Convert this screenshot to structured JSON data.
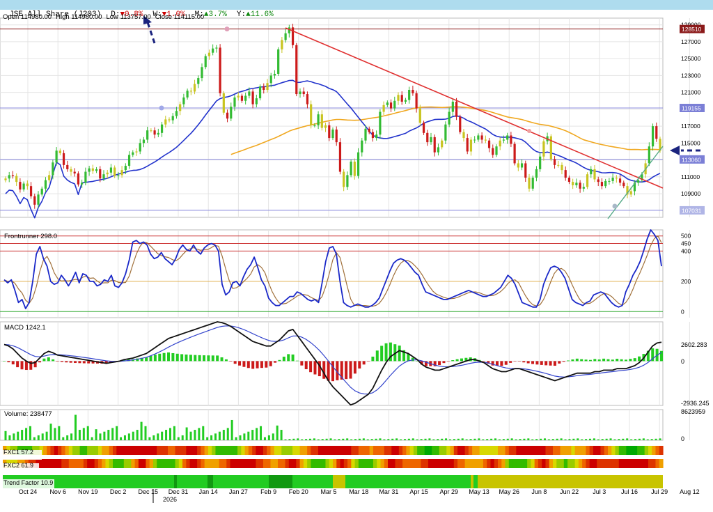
{
  "header": {
    "instrument": "JSE All Share (J203)",
    "d_label": "D:",
    "d_value": "0.8%",
    "w_label": "W:",
    "w_value": "1.0%",
    "m_label": "M:",
    "m_value": "3.7%",
    "y_label": "Y:",
    "y_value": "11.6%",
    "down_arrow": "▼",
    "up_arrow": "▲",
    "colors": {
      "down": "#cc0000",
      "up": "#118811",
      "bar": "#aedcee"
    }
  },
  "ohlc": {
    "open_label": "Open",
    "open": "114980.00",
    "high_label": "High",
    "high": "114980.00",
    "low_label": "Low",
    "low": "113757.00",
    "close_label": "Close",
    "close": "114115.00"
  },
  "chart_data": {
    "type": "candlestick",
    "x_ticks": [
      "Oct 24",
      "Nov 6",
      "Nov 19",
      "Dec 2",
      "Dec 15",
      "Dec 31",
      "Jan 14",
      "Jan 27",
      "Feb 9",
      "Feb 20",
      "Mar 5",
      "Mar 18",
      "Mar 31",
      "Apr 15",
      "Apr 29",
      "May 13",
      "May 26",
      "Jun 8",
      "Jun 22",
      "Jul 3",
      "Jul 16",
      "Jul 29",
      "Aug 12"
    ],
    "year_marker": "2026",
    "price_panel": {
      "y_ticks": [
        109000,
        111000,
        113000,
        115000,
        117000,
        119000,
        121000,
        123000,
        125000,
        127000,
        129000
      ],
      "ylim": [
        106200,
        129800
      ],
      "horizontal_levels": [
        {
          "label": "128510",
          "value": 128510,
          "color": "#8b1a1a",
          "badge": "#8b1a1a"
        },
        {
          "label": "119155",
          "value": 119155,
          "color": "#8888dd",
          "badge": "#7b7fd6"
        },
        {
          "label": "113060",
          "value": 113060,
          "color": "#8888dd",
          "badge": "#7b7fd6"
        },
        {
          "label": "107031",
          "value": 107031,
          "color": "#8888dd",
          "badge": "#b0b5e6"
        }
      ],
      "candles": [
        110800,
        111200,
        111100,
        110400,
        109500,
        110200,
        109900,
        108700,
        107700,
        108900,
        109600,
        110600,
        111200,
        112700,
        114100,
        113800,
        112400,
        111900,
        111600,
        111400,
        110100,
        110300,
        111600,
        112000,
        111700,
        111900,
        110800,
        111300,
        111500,
        112100,
        111100,
        111200,
        111800,
        112300,
        113600,
        113900,
        114000,
        115000,
        115400,
        116500,
        116500,
        116000,
        116200,
        117200,
        117800,
        117700,
        118200,
        118800,
        119600,
        120400,
        121200,
        121100,
        122000,
        122700,
        124000,
        125300,
        125700,
        126200,
        126300,
        120900,
        118600,
        117900,
        119300,
        120400,
        120600,
        120000,
        120600,
        121100,
        119600,
        120300,
        121700,
        121300,
        122100,
        123000,
        123200,
        126100,
        127200,
        128000,
        128700,
        126600,
        120800,
        121100,
        120800,
        119600,
        117100,
        117100,
        118400,
        116800,
        117100,
        115600,
        116600,
        115100,
        111600,
        109800,
        111200,
        112800,
        111100,
        113900,
        115300,
        116700,
        116300,
        115600,
        116000,
        118700,
        119500,
        119800,
        119100,
        120000,
        120700,
        119900,
        120100,
        121300,
        120900,
        119100,
        117400,
        116200,
        115100,
        115700,
        113900,
        114500,
        115300,
        117200,
        118700,
        119900,
        118100,
        116300,
        115600,
        114000,
        115400,
        115400,
        115900,
        115400,
        115300,
        114400,
        113600,
        114600,
        115300,
        115400,
        115900,
        114900,
        112600,
        112100,
        112600,
        110900,
        109600,
        110900,
        111900,
        113400,
        115200,
        115800,
        113100,
        112400,
        112400,
        111800,
        110900,
        110400,
        110000,
        110300,
        109600,
        109800,
        111300,
        111900,
        110700,
        110400,
        109900,
        110500,
        110500,
        110900,
        110800,
        110300,
        109900,
        108900,
        109300,
        110300,
        110600,
        111300,
        112600,
        114600,
        117000,
        115500,
        114100
      ]
    },
    "frontrunner": {
      "label": "Frontrunner",
      "value": "298.0",
      "y_ticks": [
        0,
        200,
        400,
        450,
        500
      ],
      "ylim": [
        -40,
        540
      ],
      "levels": [
        {
          "value": 500,
          "color": "#cc3333"
        },
        {
          "value": 450,
          "color": "#cc3333"
        },
        {
          "value": 400,
          "color": "#cc3333"
        },
        {
          "value": 200,
          "color": "#e0b050"
        },
        {
          "value": 0,
          "color": "#33aa33"
        }
      ],
      "series": [
        210,
        190,
        210,
        140,
        60,
        80,
        20,
        60,
        200,
        380,
        430,
        350,
        300,
        200,
        180,
        190,
        240,
        210,
        170,
        210,
        260,
        190,
        250,
        240,
        200,
        200,
        170,
        180,
        210,
        200,
        240,
        170,
        160,
        190,
        250,
        340,
        460,
        470,
        450,
        460,
        440,
        380,
        350,
        360,
        390,
        350,
        330,
        310,
        350,
        410,
        440,
        410,
        400,
        440,
        400,
        380,
        420,
        440,
        450,
        440,
        400,
        180,
        110,
        130,
        190,
        200,
        170,
        230,
        280,
        310,
        360,
        290,
        210,
        170,
        90,
        60,
        40,
        40,
        60,
        80,
        100,
        100,
        130,
        120,
        100,
        80,
        70,
        80,
        60,
        190,
        330,
        420,
        430,
        380,
        200,
        60,
        40,
        30,
        40,
        50,
        40,
        30,
        30,
        40,
        60,
        90,
        150,
        210,
        270,
        320,
        340,
        350,
        340,
        320,
        290,
        260,
        240,
        180,
        130,
        120,
        110,
        100,
        90,
        80,
        80,
        90,
        100,
        110,
        120,
        130,
        140,
        130,
        120,
        110,
        100,
        100,
        110,
        120,
        140,
        160,
        200,
        240,
        220,
        180,
        120,
        60,
        50,
        40,
        30,
        30,
        80,
        180,
        240,
        290,
        300,
        290,
        260,
        220,
        150,
        80,
        60,
        50,
        40,
        60,
        70,
        110,
        120,
        130,
        120,
        90,
        60,
        40,
        30,
        40,
        130,
        180,
        240,
        280,
        330,
        400,
        480,
        540,
        510,
        470,
        300
      ]
    },
    "macd": {
      "label": "MACD",
      "value": "1242.1",
      "y_ticks": [
        "2602.283",
        "0",
        "-2936.245"
      ],
      "ylim": [
        -2936.245,
        2602.283
      ],
      "macd_series": [
        1100,
        1000,
        800,
        500,
        200,
        0,
        -150,
        -100,
        200,
        500,
        650,
        550,
        400,
        350,
        300,
        250,
        200,
        150,
        100,
        50,
        0,
        -50,
        -100,
        -150,
        -100,
        -50,
        0,
        100,
        150,
        200,
        300,
        400,
        500,
        700,
        900,
        1100,
        1300,
        1500,
        1600,
        1700,
        1800,
        1900,
        2000,
        2100,
        2200,
        2300,
        2400,
        2500,
        2600,
        2550,
        2450,
        2300,
        2100,
        1900,
        1700,
        1500,
        1300,
        1200,
        1100,
        1000,
        1000,
        1200,
        1400,
        1700,
        2000,
        2100,
        1700,
        1300,
        900,
        500,
        100,
        -300,
        -800,
        -1300,
        -1700,
        -2000,
        -2300,
        -2600,
        -2900,
        -2800,
        -2600,
        -2400,
        -2200,
        -1800,
        -1200,
        -600,
        -100,
        300,
        500,
        700,
        600,
        500,
        300,
        100,
        -200,
        -400,
        -500,
        -600,
        -600,
        -500,
        -400,
        -300,
        -200,
        -100,
        0,
        100,
        100,
        0,
        -100,
        -300,
        -500,
        -600,
        -700,
        -700,
        -600,
        -500,
        -500,
        -600,
        -700,
        -800,
        -900,
        -1000,
        -1100,
        -1200,
        -1300,
        -1200,
        -1100,
        -1000,
        -900,
        -800,
        -800,
        -800,
        -800,
        -700,
        -700,
        -600,
        -600,
        -600,
        -500,
        -500,
        -500,
        -400,
        -300,
        -100,
        200,
        600,
        1000,
        1200,
        1250
      ]
    },
    "volume": {
      "label": "Volume",
      "value": "238477",
      "y_ticks": [
        "8623959",
        "0"
      ],
      "ylim": [
        0,
        8623959
      ]
    },
    "fxc1": {
      "label": "FXC1",
      "value": "57.2"
    },
    "fxc2": {
      "label": "FXC2",
      "value": "61.9"
    },
    "trend_factor": {
      "label": "Trend Factor",
      "value": "10.9"
    }
  }
}
